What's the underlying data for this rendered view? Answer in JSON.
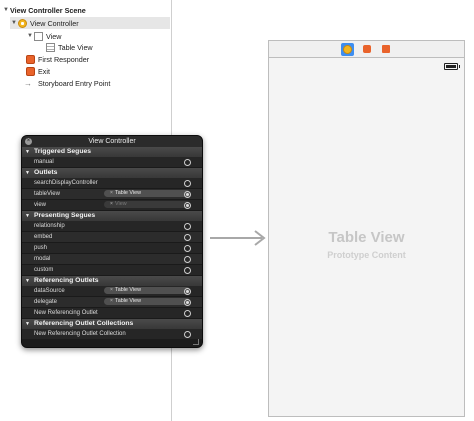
{
  "outline": {
    "scene_title": "View Controller Scene",
    "view_controller": "View Controller",
    "view": "View",
    "table_view": "Table View",
    "first_responder": "First Responder",
    "exit": "Exit",
    "entry_point": "Storyboard Entry Point"
  },
  "hud": {
    "title": "View Controller",
    "sections": {
      "triggered_segues": "Triggered Segues",
      "outlets": "Outlets",
      "presenting_segues": "Presenting Segues",
      "referencing_outlets": "Referencing Outlets",
      "referencing_outlet_collections": "Referencing Outlet Collections"
    },
    "rows": {
      "manual": "manual",
      "search_display_controller": "searchDisplayController",
      "table_view": "tableView",
      "view": "view",
      "relationship": "relationship",
      "embed": "embed",
      "push": "push",
      "modal": "modal",
      "custom": "custom",
      "data_source": "dataSource",
      "delegate": "delegate",
      "new_referencing_outlet": "New Referencing Outlet",
      "new_referencing_outlet_collection": "New Referencing Outlet Collection"
    },
    "connections": {
      "table_view": "Table View",
      "view": "View",
      "data_source": "Table View",
      "delegate": "Table View"
    }
  },
  "scene": {
    "title": "Table View",
    "subtitle": "Prototype Content"
  },
  "icons": {
    "scene_dock": [
      "view-controller-icon",
      "first-responder-icon",
      "exit-icon"
    ],
    "status_bar": "battery-icon"
  },
  "colors": {
    "accent": "#3d8ef0",
    "vc_yellow": "#f2b51f",
    "responder_orange": "#e9632b"
  }
}
